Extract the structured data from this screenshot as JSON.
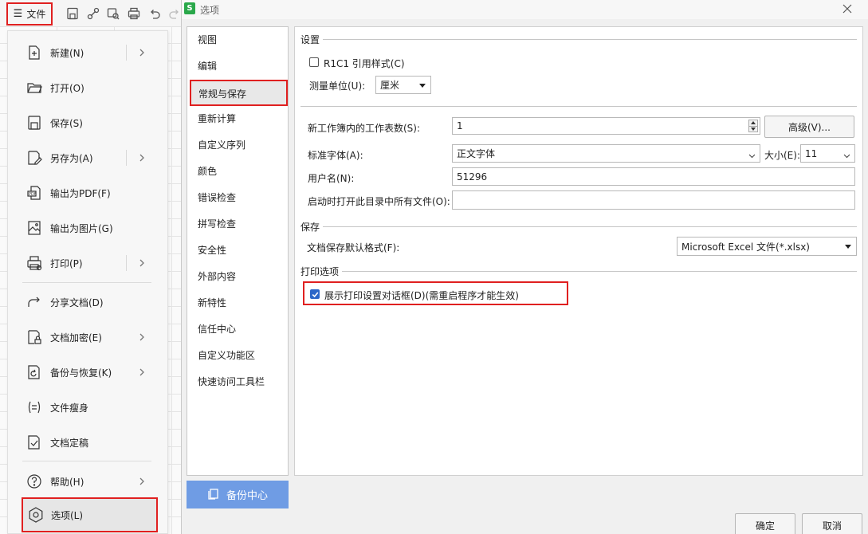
{
  "toolbar": {
    "file_label": "文件",
    "icons": [
      "hamburger-icon",
      "save-icon",
      "share-icon",
      "find-icon",
      "print-preview-icon",
      "undo-icon",
      "redo-icon"
    ]
  },
  "file_menu": {
    "items": [
      {
        "label": "新建(N)",
        "icon": "new-file-icon"
      },
      {
        "label": "打开(O)",
        "icon": "open-folder-icon"
      },
      {
        "label": "保存(S)",
        "icon": "save-icon"
      },
      {
        "label": "另存为(A)",
        "icon": "save-as-icon"
      },
      {
        "label": "输出为PDF(F)",
        "icon": "export-pdf-icon"
      },
      {
        "label": "输出为图片(G)",
        "icon": "export-image-icon"
      },
      {
        "label": "打印(P)",
        "icon": "print-icon"
      },
      {
        "label": "分享文档(D)",
        "icon": "share-icon"
      },
      {
        "label": "文档加密(E)",
        "icon": "encrypt-icon"
      },
      {
        "label": "备份与恢复(K)",
        "icon": "backup-icon"
      },
      {
        "label": "文件瘦身",
        "icon": "compress-icon"
      },
      {
        "label": "文档定稿",
        "icon": "finalize-icon"
      },
      {
        "label": "帮助(H)",
        "icon": "help-icon"
      },
      {
        "label": "选项(L)",
        "icon": "options-icon"
      }
    ]
  },
  "dialog": {
    "logo": "S",
    "title": "选项",
    "nav": [
      "视图",
      "编辑",
      "常规与保存",
      "重新计算",
      "自定义序列",
      "颜色",
      "错误检查",
      "拼写检查",
      "安全性",
      "外部内容",
      "新特性",
      "信任中心",
      "自定义功能区",
      "快速访问工具栏"
    ],
    "active_nav": "常规与保存",
    "backup_label": "备份中心",
    "settings": {
      "heading": "设置",
      "r1c1_label": "R1C1 引用样式(C)",
      "r1c1_checked": false,
      "unit_label": "测量单位(U):",
      "unit_value": "厘米",
      "sheets_label": "新工作簿内的工作表数(S):",
      "sheets_value": "1",
      "advanced_label": "高级(V)...",
      "font_label": "标准字体(A):",
      "font_value": "正文字体",
      "size_label": "大小(E):",
      "size_value": "11",
      "username_label": "用户名(N):",
      "username_value": "51296",
      "startup_label": "启动时打开此目录中所有文件(O):",
      "startup_value": ""
    },
    "save": {
      "heading": "保存",
      "format_label": "文档保存默认格式(F):",
      "format_value": "Microsoft Excel 文件(*.xlsx)"
    },
    "print": {
      "heading": "打印选项",
      "show_dialog_label": "展示打印设置对话框(D)(需重启程序才能生效)",
      "show_dialog_checked": true
    },
    "ok_label": "确定",
    "cancel_label": "取消",
    "colors": {
      "highlight": "#e02020",
      "accent": "#2b66c8",
      "backup_bg": "#6f9ce4"
    }
  }
}
